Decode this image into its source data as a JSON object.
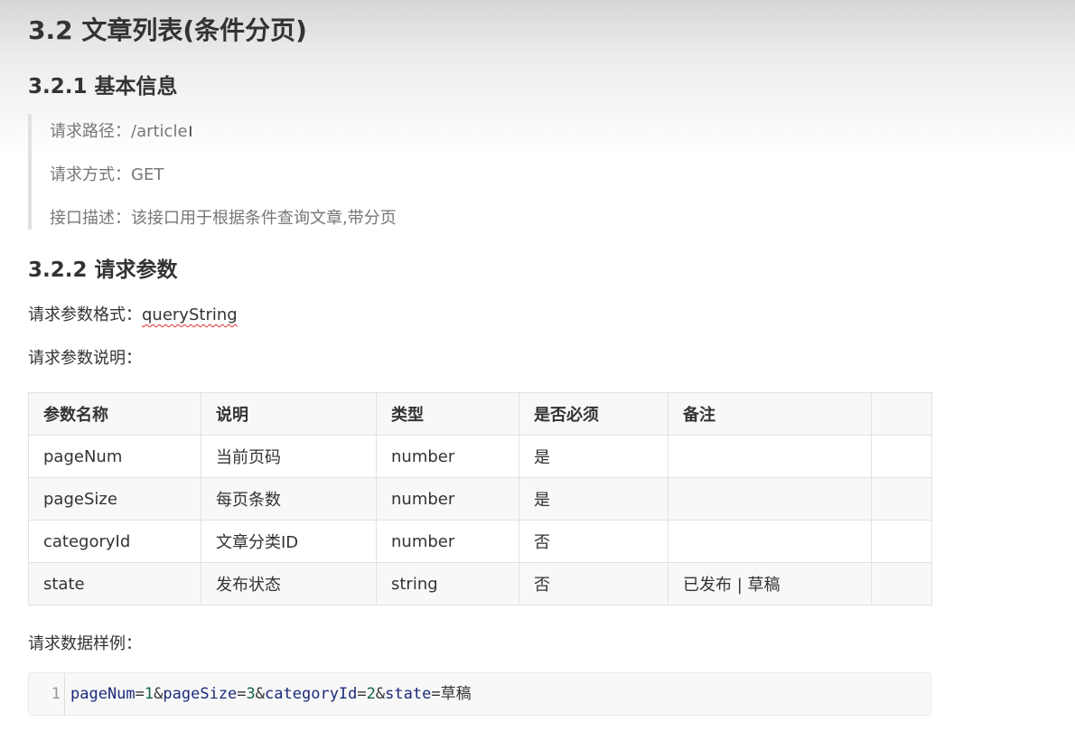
{
  "heading": "3.2 文章列表(条件分页)",
  "section_basic": {
    "title": "3.2.1 基本信息",
    "path_label": "请求路径：",
    "path_value": "/article",
    "method_label": "请求方式：",
    "method_value": "GET",
    "desc_label": "接口描述：",
    "desc_value": "该接口用于根据条件查询文章,带分页"
  },
  "section_params": {
    "title": "3.2.2 请求参数",
    "format_label": "请求参数格式：",
    "format_value": "queryString",
    "explain_label": "请求参数说明："
  },
  "table": {
    "headers": [
      "参数名称",
      "说明",
      "类型",
      "是否必须",
      "备注",
      ""
    ],
    "rows": [
      [
        "pageNum",
        "当前页码",
        "number",
        "是",
        "",
        ""
      ],
      [
        "pageSize",
        "每页条数",
        "number",
        "是",
        "",
        ""
      ],
      [
        "categoryId",
        "文章分类ID",
        "number",
        "否",
        "",
        ""
      ],
      [
        "state",
        "发布状态",
        "string",
        "否",
        "已发布 | 草稿",
        ""
      ]
    ]
  },
  "sample": {
    "label": "请求数据样例：",
    "line_number": "1",
    "tokens": [
      {
        "text": "pageNum",
        "kind": "key"
      },
      {
        "text": "=",
        "kind": "op"
      },
      {
        "text": "1",
        "kind": "num"
      },
      {
        "text": "&",
        "kind": "op"
      },
      {
        "text": "pageSize",
        "kind": "key"
      },
      {
        "text": "=",
        "kind": "op"
      },
      {
        "text": "3",
        "kind": "num"
      },
      {
        "text": "&",
        "kind": "op"
      },
      {
        "text": "categoryId",
        "kind": "key"
      },
      {
        "text": "=",
        "kind": "op"
      },
      {
        "text": "2",
        "kind": "num"
      },
      {
        "text": "&",
        "kind": "op"
      },
      {
        "text": "state",
        "kind": "key"
      },
      {
        "text": "=",
        "kind": "op"
      },
      {
        "text": "草稿",
        "kind": "val"
      }
    ]
  },
  "colors": {
    "code_key": "#1c2a7a",
    "code_number": "#116644",
    "spellcheck_underline": "#e03030"
  }
}
